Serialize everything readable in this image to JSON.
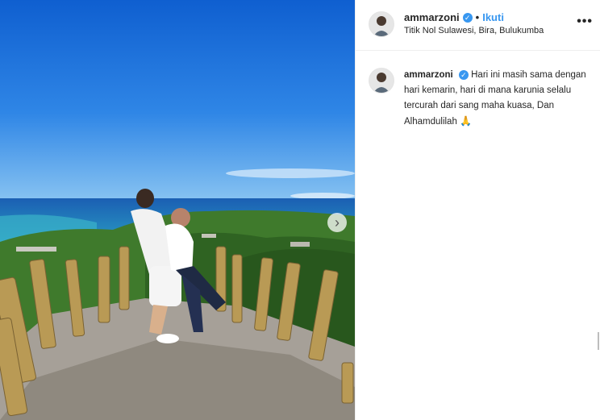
{
  "post": {
    "username": "ammarzoni",
    "verified_icon": "verified-badge-icon",
    "separator": "•",
    "follow_label": "Ikuti",
    "location": "Titik Nol Sulawesi, Bira, Bulukumba",
    "more_label": "•••",
    "caption_text": "Hari ini masih sama dengan hari kemarin, hari di mana karunia selalu tercurah dari sang maha kuasa, Dan Alhamdulilah",
    "caption_emoji": "🙏",
    "next_label": "›"
  },
  "colors": {
    "accent": "#3897f0",
    "sky": "#1f6fd6",
    "text": "#262626"
  }
}
